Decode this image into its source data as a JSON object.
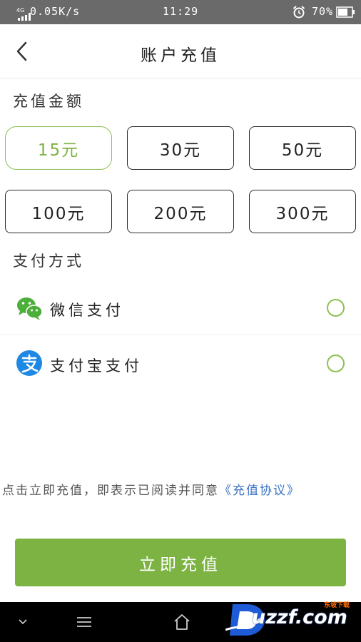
{
  "status_bar": {
    "network_type": "4G",
    "net_speed": "0.05K/s",
    "time": "11:29",
    "battery": "70%"
  },
  "header": {
    "title": "账户充值"
  },
  "amount_section": {
    "title": "充值金额",
    "options": [
      {
        "label": "15元",
        "selected": true
      },
      {
        "label": "30元",
        "selected": false
      },
      {
        "label": "50元",
        "selected": false
      },
      {
        "label": "100元",
        "selected": false
      },
      {
        "label": "200元",
        "selected": false
      },
      {
        "label": "300元",
        "selected": false
      }
    ]
  },
  "payment_section": {
    "title": "支付方式",
    "methods": [
      {
        "label": "微信支付",
        "icon": "wechat-icon",
        "selected": false
      },
      {
        "label": "支付宝支付",
        "icon": "alipay-icon",
        "selected": false
      }
    ]
  },
  "agreement": {
    "text": "点击立即充值，即表示已阅读并同意",
    "link": "《充值协议》"
  },
  "recharge_button": {
    "label": "立即充值"
  },
  "watermark": {
    "text": "uzzf.com",
    "sub": "东坡下载"
  },
  "colors": {
    "accent": "#7cb342",
    "accent_border": "#8cc152",
    "link": "#3b72c4",
    "status_bar": "#6a6a6a",
    "nav_bar": "#000000"
  }
}
